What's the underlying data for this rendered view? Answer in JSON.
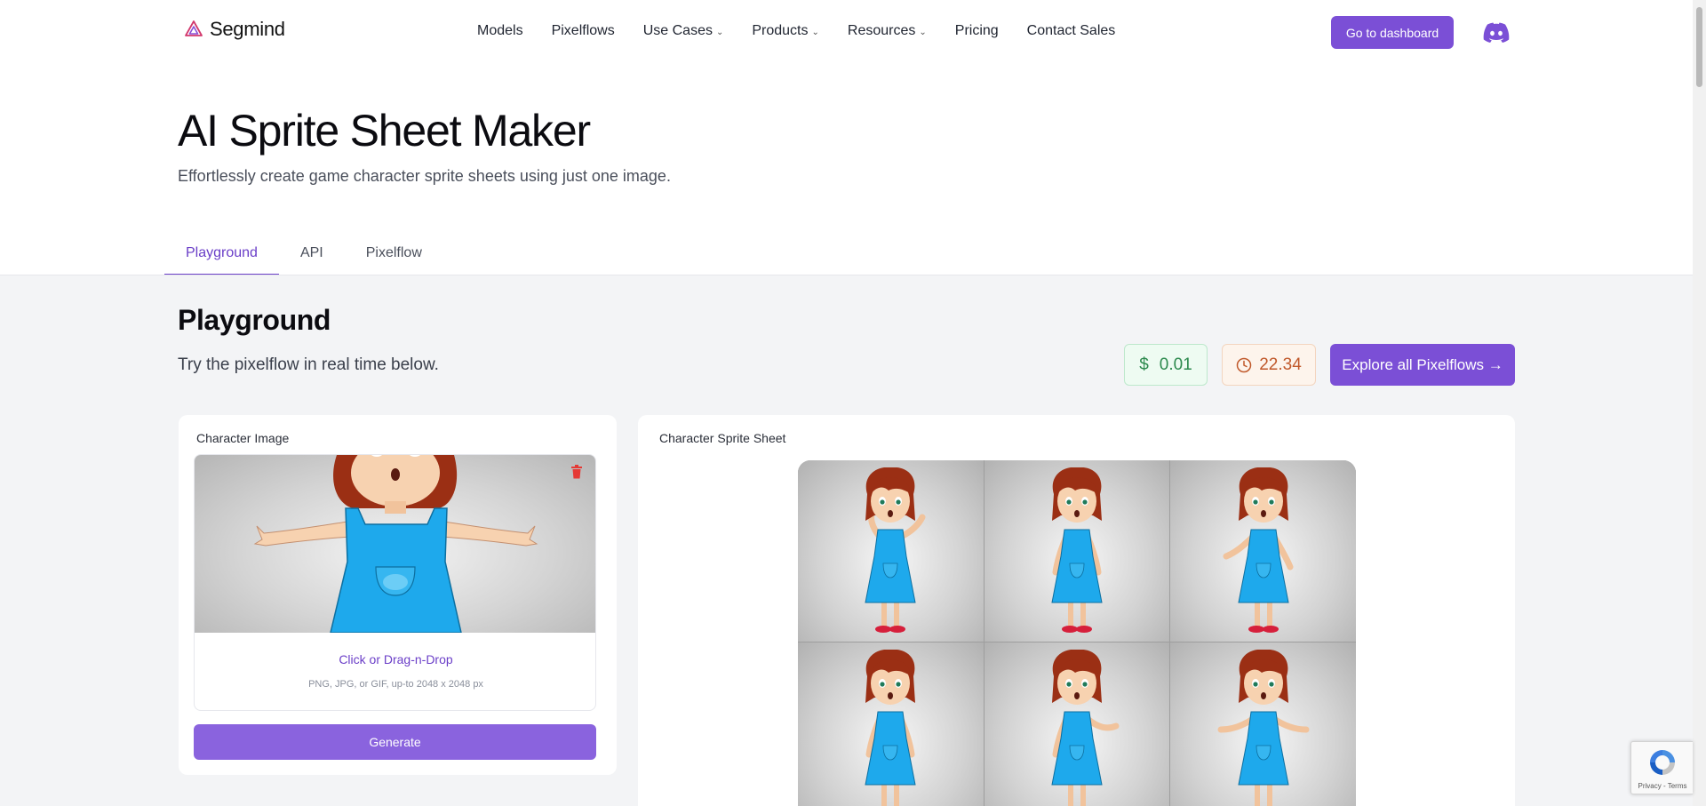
{
  "brand": {
    "name": "Segmind",
    "accent": "#7b4fd6"
  },
  "nav": {
    "links": [
      {
        "label": "Models",
        "dropdown": false
      },
      {
        "label": "Pixelflows",
        "dropdown": false
      },
      {
        "label": "Use Cases",
        "dropdown": true
      },
      {
        "label": "Products",
        "dropdown": true
      },
      {
        "label": "Resources",
        "dropdown": true
      },
      {
        "label": "Pricing",
        "dropdown": false
      },
      {
        "label": "Contact Sales",
        "dropdown": false
      }
    ],
    "dashboard_label": "Go to dashboard",
    "discord_icon": "discord-icon"
  },
  "hero": {
    "title": "AI Sprite Sheet Maker",
    "subtitle": "Effortlessly create game character sprite sheets using just one image."
  },
  "tabs": [
    {
      "label": "Playground",
      "active": true
    },
    {
      "label": "API",
      "active": false
    },
    {
      "label": "Pixelflow",
      "active": false
    }
  ],
  "playground": {
    "title": "Playground",
    "subtitle": "Try the pixelflow in real time below.",
    "cost_symbol": "$",
    "cost": "0.01",
    "time": "22.34",
    "explore_label": "Explore all Pixelflows →"
  },
  "input_card": {
    "label": "Character Image",
    "upload_cta": "Click or Drag-n-Drop",
    "upload_hint": "PNG, JPG, or GIF, up-to 2048 x 2048 px",
    "generate_label": "Generate"
  },
  "output_card": {
    "label": "Character Sprite Sheet",
    "poses": [
      "wave-left",
      "stand",
      "shrug-small",
      "stand-arms-down",
      "point-right",
      "shrug"
    ]
  },
  "recaptcha": {
    "text": "Privacy - Terms"
  }
}
